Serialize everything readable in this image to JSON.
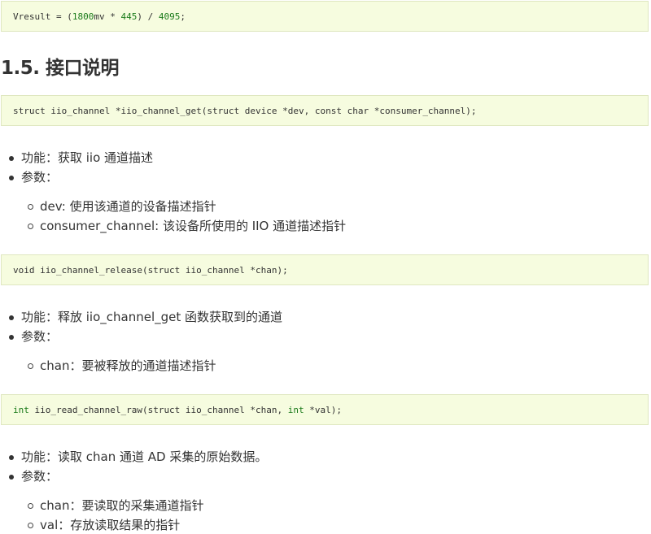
{
  "code_blocks": [
    {
      "parts": [
        "Vresult = (",
        "1800",
        "mv * ",
        "445",
        ") / ",
        "4095",
        ";"
      ]
    },
    {
      "text": "struct iio_channel *iio_channel_get(struct device *dev, const char *consumer_channel);"
    },
    {
      "text": "void iio_channel_release(struct iio_channel *chan);"
    },
    {
      "parts": [
        "int",
        " iio_read_channel_raw(struct iio_channel *chan, ",
        "int",
        " *val);"
      ]
    }
  ],
  "heading": "1.5. 接口说明",
  "section1": {
    "items": [
      "功能：获取 iio 通道描述",
      "参数："
    ],
    "sub": [
      "dev: 使用该通道的设备描述指针",
      "consumer_channel: 该设备所使用的 IIO 通道描述指针"
    ]
  },
  "section2": {
    "items": [
      "功能：释放 iio_channel_get 函数获取到的通道",
      "参数："
    ],
    "sub": [
      "chan：要被释放的通道描述指针"
    ]
  },
  "section3": {
    "items": [
      "功能：读取 chan 通道 AD 采集的原始数据。",
      "参数："
    ],
    "sub": [
      "chan：要读取的采集通道指针",
      "val：存放读取结果的指针"
    ]
  }
}
